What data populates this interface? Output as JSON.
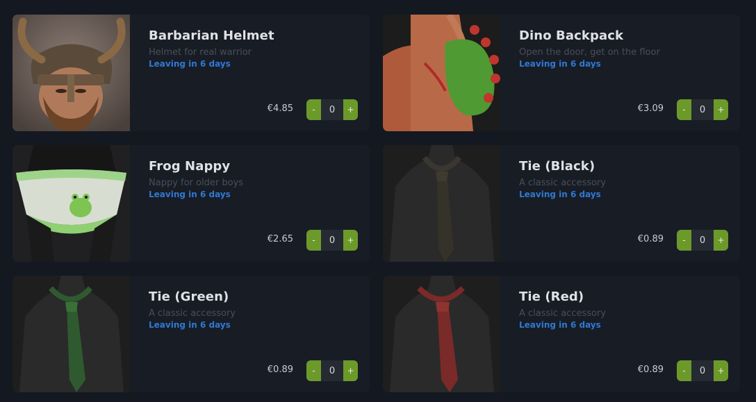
{
  "items": [
    {
      "name": "Barbarian Helmet",
      "description": "Helmet for real warrior",
      "leaving": "Leaving in 6 days",
      "price": "€4.85",
      "qty": "0",
      "minus": "-",
      "plus": "+"
    },
    {
      "name": "Dino Backpack",
      "description": "Open the door, get on the floor",
      "leaving": "Leaving in 6 days",
      "price": "€3.09",
      "qty": "0",
      "minus": "-",
      "plus": "+"
    },
    {
      "name": "Frog Nappy",
      "description": "Nappy for older boys",
      "leaving": "Leaving in 6 days",
      "price": "€2.65",
      "qty": "0",
      "minus": "-",
      "plus": "+"
    },
    {
      "name": "Tie (Black)",
      "description": "A classic accessory",
      "leaving": "Leaving in 6 days",
      "price": "€0.89",
      "qty": "0",
      "minus": "-",
      "plus": "+"
    },
    {
      "name": "Tie (Green)",
      "description": "A classic accessory",
      "leaving": "Leaving in 6 days",
      "price": "€0.89",
      "qty": "0",
      "minus": "-",
      "plus": "+"
    },
    {
      "name": "Tie (Red)",
      "description": "A classic accessory",
      "leaving": "Leaving in 6 days",
      "price": "€0.89",
      "qty": "0",
      "minus": "-",
      "plus": "+"
    }
  ],
  "colors": {
    "background": "#141820",
    "card": "#181c25",
    "accent_green": "#6c9a2a",
    "leaving_blue": "#2f79d3"
  }
}
